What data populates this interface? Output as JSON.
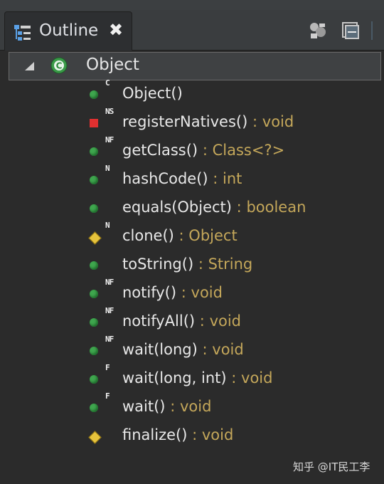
{
  "tab": {
    "title": "Outline",
    "close_glyph": "✖"
  },
  "toolbar": {
    "buttons": [
      "hide-fields-icon",
      "collapse-all-icon",
      "view-menu-icon"
    ]
  },
  "root": {
    "label": "Object",
    "icon": "class-c-icon",
    "expanded": true
  },
  "separator": ":",
  "members": [
    {
      "name": "Object()",
      "return_type": "",
      "visibility": "public",
      "modifiers": "C"
    },
    {
      "name": "registerNatives()",
      "return_type": "void",
      "visibility": "private",
      "modifiers": "NS"
    },
    {
      "name": "getClass()",
      "return_type": "Class<?>",
      "visibility": "public",
      "modifiers": "NF"
    },
    {
      "name": "hashCode()",
      "return_type": "int",
      "visibility": "public",
      "modifiers": "N"
    },
    {
      "name": "equals(Object)",
      "return_type": "boolean",
      "visibility": "public",
      "modifiers": ""
    },
    {
      "name": "clone()",
      "return_type": "Object",
      "visibility": "protected",
      "modifiers": "N"
    },
    {
      "name": "toString()",
      "return_type": "String",
      "visibility": "public",
      "modifiers": ""
    },
    {
      "name": "notify()",
      "return_type": "void",
      "visibility": "public",
      "modifiers": "NF"
    },
    {
      "name": "notifyAll()",
      "return_type": "void",
      "visibility": "public",
      "modifiers": "NF"
    },
    {
      "name": "wait(long)",
      "return_type": "void",
      "visibility": "public",
      "modifiers": "NF"
    },
    {
      "name": "wait(long, int)",
      "return_type": "void",
      "visibility": "public",
      "modifiers": "F"
    },
    {
      "name": "wait()",
      "return_type": "void",
      "visibility": "public",
      "modifiers": "F"
    },
    {
      "name": "finalize()",
      "return_type": "void",
      "visibility": "protected",
      "modifiers": ""
    }
  ],
  "watermark": "知乎 @IT民工李",
  "colors": {
    "name": "#e8e8e8",
    "type": "#c4a75a",
    "public": "#3fa64e",
    "protected": "#e6c33c",
    "private": "#e03030"
  }
}
